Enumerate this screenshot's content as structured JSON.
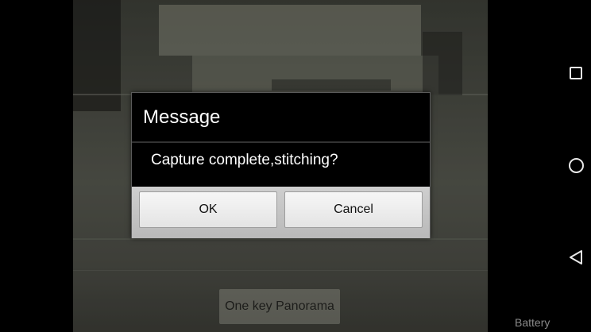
{
  "dialog": {
    "title": "Message",
    "message": "Capture complete,stitching?",
    "ok_label": "OK",
    "cancel_label": "Cancel"
  },
  "camera": {
    "panorama_button_label": "One key Panorama"
  },
  "status": {
    "battery_label": "Battery"
  },
  "navigation": {
    "icons": [
      "recents-icon",
      "home-icon",
      "back-icon"
    ]
  },
  "colors": {
    "dialog_background": "#000000",
    "button_bar": "#c4c4c4",
    "button_face": "#eeeeee",
    "text_light": "#ffffff",
    "nav_icon": "#e8e8e8"
  }
}
